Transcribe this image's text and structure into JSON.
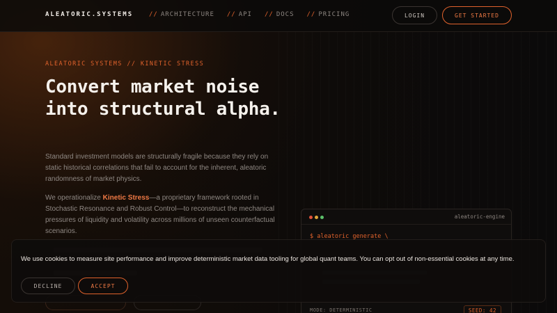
{
  "nav": {
    "brand": "ALEATORIC.SYSTEMS",
    "links": [
      {
        "prefix": "//",
        "label": "ARCHITECTURE"
      },
      {
        "prefix": "//",
        "label": "API"
      },
      {
        "prefix": "//",
        "label": "DOCS"
      },
      {
        "prefix": "//",
        "label": "PRICING"
      }
    ],
    "login_label": "LOGIN",
    "get_started_label": "GET STARTED"
  },
  "hero": {
    "eyebrow": "ALEATORIC SYSTEMS // KINETIC STRESS",
    "headline": "Convert market noise into structural alpha.",
    "paragraph1": "Standard investment models are structurally fragile because they rely on static historical correlations that fail to account for the inherent, aleatoric randomness of market physics.",
    "paragraph2_before": "We operationalize ",
    "paragraph2_highlight": "Kinetic Stress",
    "paragraph2_after": "—a proprietary framework rooted in Stochastic Resonance and Robust Control—to reconstruct the mechanical pressures of liquidity and volatility across millions of unseen counterfactual scenarios."
  },
  "terminal": {
    "title": "aleatoric-engine",
    "command": "$ aleatoric generate \\",
    "mode": "MODE: DETERMINISTIC",
    "seed": "SEED: 42"
  },
  "cookie": {
    "message": "We use cookies to measure site performance and improve deterministic market data tooling for global quant teams. You can opt out of non-essential cookies at any time.",
    "decline_label": "DECLINE",
    "accept_label": "ACCEPT"
  },
  "colors": {
    "accent": "#e0622c",
    "background": "#0b0908",
    "text": "#f5f1ec"
  }
}
